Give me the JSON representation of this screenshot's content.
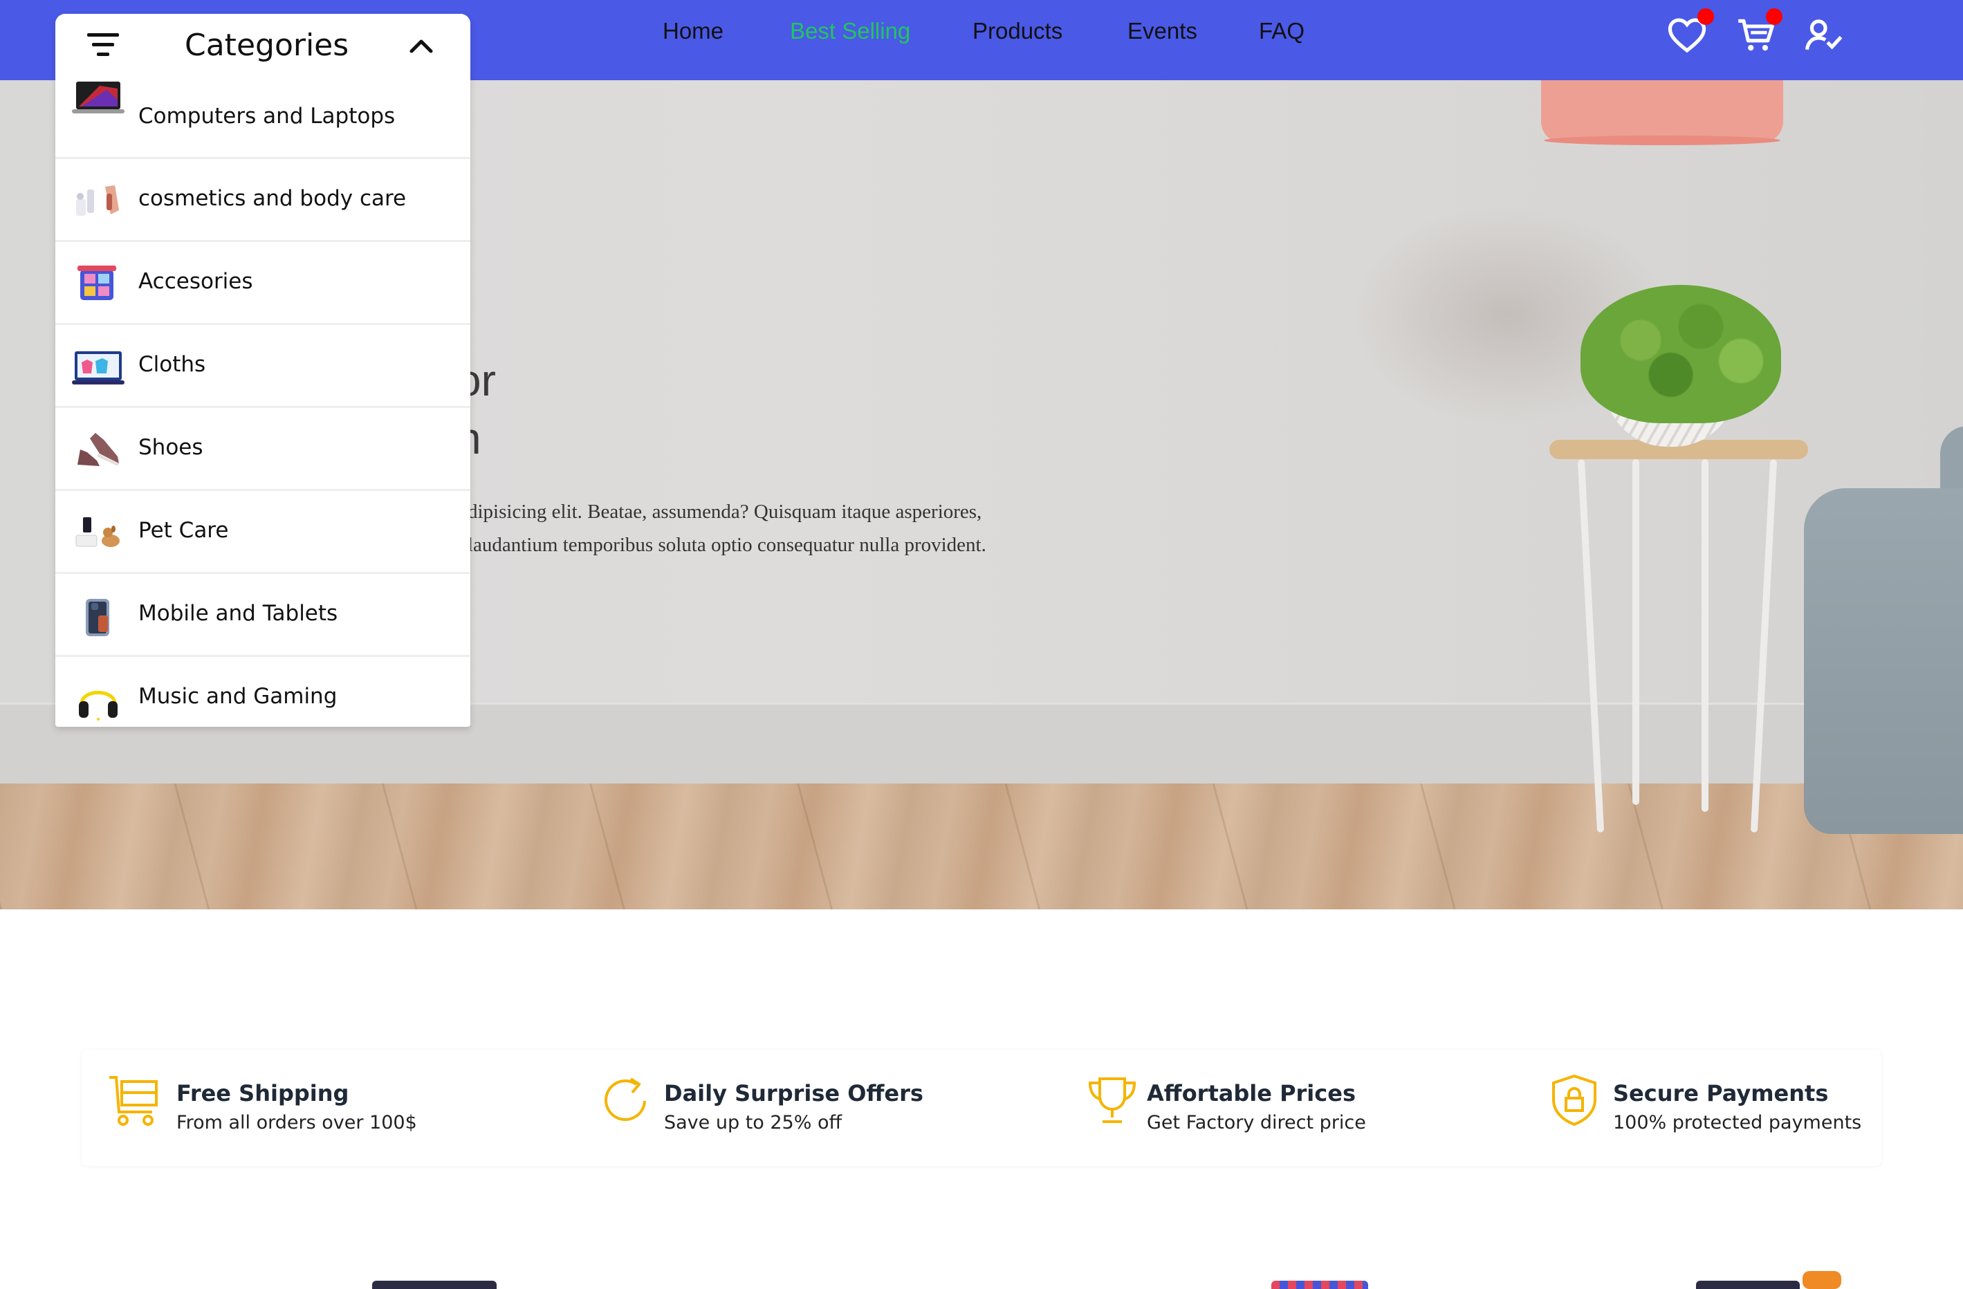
{
  "navbar": {
    "links": [
      {
        "label": "Home",
        "active": false
      },
      {
        "label": "Best Selling",
        "active": true
      },
      {
        "label": "Products",
        "active": false
      },
      {
        "label": "Events",
        "active": false
      },
      {
        "label": "FAQ",
        "active": false
      }
    ],
    "icons": [
      "heart-icon",
      "cart-icon",
      "user-check-icon"
    ]
  },
  "categories": {
    "title": "Categories",
    "expanded": true,
    "items": [
      {
        "label": "Computers and Laptops",
        "icon": "laptop-thumbnail"
      },
      {
        "label": "cosmetics and body care",
        "icon": "cosmetics-thumbnail"
      },
      {
        "label": "Accesories",
        "icon": "accessories-thumbnail"
      },
      {
        "label": "Cloths",
        "icon": "cloths-thumbnail"
      },
      {
        "label": "Shoes",
        "icon": "shoes-thumbnail"
      },
      {
        "label": "Pet Care",
        "icon": "pet-care-thumbnail"
      },
      {
        "label": "Mobile and Tablets",
        "icon": "mobile-thumbnail"
      },
      {
        "label": "Music and Gaming",
        "icon": "headphones-thumbnail"
      }
    ]
  },
  "hero": {
    "title_partial": "or\nn",
    "text_partial": "dipisicing elit. Beatae, assumenda? Quisquam itaque asperiores, laudantium temporibus soluta optio consequatur nulla provident."
  },
  "features": [
    {
      "title": "Free Shipping",
      "subtitle": "From all orders over 100$",
      "icon": "shopping-cart-icon"
    },
    {
      "title": "Daily Surprise Offers",
      "subtitle": "Save up to 25% off",
      "icon": "refresh-icon"
    },
    {
      "title": "Affortable Prices",
      "subtitle": "Get Factory direct price",
      "icon": "trophy-icon"
    },
    {
      "title": "Secure Payments",
      "subtitle": "100% protected payments",
      "icon": "shield-lock-icon"
    }
  ],
  "colors": {
    "navbar_bg": "#4a59e6",
    "active_link": "#22c55e",
    "badge": "#ff0000",
    "feature_icon": "#f5b400"
  }
}
